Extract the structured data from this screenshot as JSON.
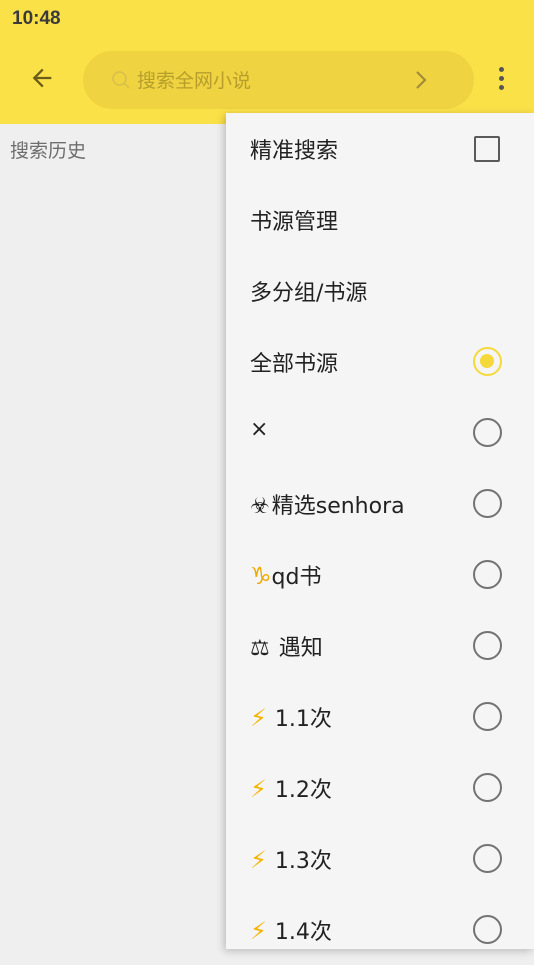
{
  "status_bar": {
    "time": "10:48"
  },
  "app_bar": {
    "search_placeholder": "搜索全网小说",
    "back_icon": "arrow-left-icon",
    "more_icon": "more-vertical-icon",
    "search_icon": "search-icon",
    "chevron_icon": "chevron-right-icon"
  },
  "content": {
    "history_label": "搜索历史"
  },
  "menu": {
    "items": [
      {
        "label": "精准搜索",
        "control": "checkbox",
        "checked": false
      },
      {
        "label": "书源管理",
        "control": "none"
      },
      {
        "label": "多分组/书源",
        "control": "none"
      },
      {
        "label": "全部书源",
        "control": "radio",
        "selected": true
      },
      {
        "label": "×",
        "control": "radio",
        "selected": false
      },
      {
        "emoji": "☣",
        "label": "精选senhora",
        "control": "radio",
        "selected": false
      },
      {
        "emoji": "♑",
        "label": "qd书",
        "control": "radio",
        "selected": false
      },
      {
        "emoji": "⚖",
        "label": " 遇知",
        "control": "radio",
        "selected": false
      },
      {
        "emoji": "⚡",
        "label": "1.1次",
        "control": "radio",
        "selected": false
      },
      {
        "emoji": "⚡",
        "label": "1.2次",
        "control": "radio",
        "selected": false
      },
      {
        "emoji": "⚡",
        "label": "1.3次",
        "control": "radio",
        "selected": false
      },
      {
        "emoji": "⚡",
        "label": "1.4次",
        "control": "radio",
        "selected": false
      }
    ]
  },
  "colors": {
    "accent": "#fbe148",
    "search_field": "#f0d340",
    "menu_bg": "#f5f5f5",
    "radio_selected": "#f5d93a"
  }
}
